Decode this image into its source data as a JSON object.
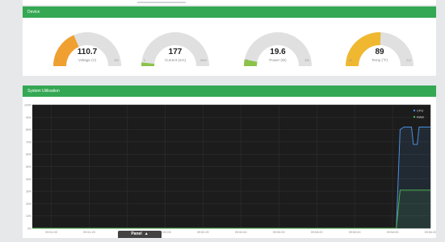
{
  "panels": {
    "device_title": "Device",
    "util_title": "System Utilisation"
  },
  "gauges": [
    {
      "value": "110.7",
      "label": "Voltage (V)",
      "min": "0",
      "max": "300",
      "fraction": 0.369,
      "color": "#f0a030"
    },
    {
      "value": "177",
      "label": "Current (mA)",
      "min": "0",
      "max": "5000",
      "fraction": 0.035,
      "color": "#8bc34a"
    },
    {
      "value": "19.6",
      "label": "Power (W)",
      "min": "0",
      "max": "300",
      "fraction": 0.065,
      "color": "#8bc34a"
    },
    {
      "value": "89",
      "label": "Temp (°F)",
      "min": "-40",
      "max": "212",
      "fraction": 0.51,
      "color": "#f0b830"
    }
  ],
  "chart_data": {
    "type": "area",
    "title": "",
    "xlabel": "",
    "ylabel": "",
    "x": [
      "09:51:00",
      "09:51:20",
      "09:51:40",
      "09:52:00",
      "09:52:20",
      "09:52:40",
      "09:53:00",
      "09:53:20",
      "09:53:40",
      "09:54:00",
      "09:54:20",
      "09:54:40"
    ],
    "ylim": [
      0,
      100
    ],
    "yticks": [
      "0%",
      "10%",
      "20%",
      "30%",
      "40%",
      "50%",
      "60%",
      "70%",
      "80%",
      "90%",
      "100%"
    ],
    "series": [
      {
        "name": "CPU",
        "color": "#4a90e2",
        "points": [
          [
            0,
            0
          ],
          [
            9.6,
            0
          ],
          [
            9.7,
            80
          ],
          [
            9.8,
            82
          ],
          [
            10.0,
            82
          ],
          [
            10.05,
            68
          ],
          [
            10.15,
            68
          ],
          [
            10.2,
            82
          ],
          [
            10.5,
            82
          ]
        ]
      },
      {
        "name": "RAM",
        "color": "#4caf50",
        "points": [
          [
            0,
            0
          ],
          [
            9.6,
            0
          ],
          [
            9.7,
            31
          ],
          [
            10.5,
            31
          ]
        ]
      }
    ],
    "legend": "top-right",
    "grid": true
  },
  "bottom_tab": {
    "label": "Panel",
    "chevron": "^"
  }
}
